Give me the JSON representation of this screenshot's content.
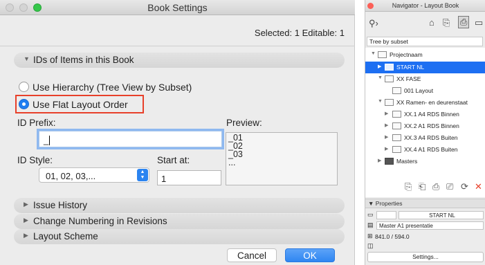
{
  "dialog": {
    "title": "Book Settings",
    "selection_info": "Selected: 1 Editable: 1",
    "sections": {
      "ids": "IDs of Items in this Book",
      "issue_history": "Issue History",
      "change_numbering": "Change Numbering in Revisions",
      "layout_scheme": "Layout Scheme"
    },
    "options": {
      "hierarchy": "Use Hierarchy (Tree View by Subset)",
      "flat": "Use Flat Layout Order",
      "selected": "flat"
    },
    "id_prefix": {
      "label": "ID Prefix:",
      "value": "_"
    },
    "preview": {
      "label": "Preview:",
      "lines": [
        "_01",
        "_02",
        "_03",
        "..."
      ]
    },
    "id_style": {
      "label": "ID Style:",
      "value": "01, 02, 03,..."
    },
    "start_at": {
      "label": "Start at:",
      "value": "1"
    },
    "buttons": {
      "cancel": "Cancel",
      "ok": "OK"
    },
    "colors": {
      "accent": "#2f86f1",
      "highlight_box": "#e8402a"
    }
  },
  "navigator": {
    "title": "Navigator - Layout Book",
    "tree_mode": "Tree by subset",
    "tree": [
      {
        "label": "Projectnaam",
        "depth": 0,
        "expanded": true,
        "icon": "book-icon"
      },
      {
        "label": "START NL",
        "depth": 1,
        "expanded": false,
        "selected": true,
        "icon": "layout-icon"
      },
      {
        "label": "XX FASE",
        "depth": 1,
        "expanded": true,
        "icon": "subset-icon"
      },
      {
        "label": "001 Layout",
        "depth": 2,
        "leaf": true,
        "icon": "layout-icon"
      },
      {
        "label": "XX Ramen- en deurenstaat",
        "depth": 1,
        "expanded": true,
        "icon": "subset-icon"
      },
      {
        "label": "XX.1 A4 RDS Binnen",
        "depth": 2,
        "expanded": false,
        "icon": "layout-icon"
      },
      {
        "label": "XX.2 A1 RDS Binnen",
        "depth": 2,
        "expanded": false,
        "icon": "layout-icon"
      },
      {
        "label": "XX.3 A4 RDS Buiten",
        "depth": 2,
        "expanded": false,
        "icon": "layout-icon"
      },
      {
        "label": "XX.4 A1 RDS Buiten",
        "depth": 2,
        "expanded": false,
        "icon": "layout-icon"
      },
      {
        "label": "Masters",
        "depth": 1,
        "expanded": false,
        "icon": "folder-icon"
      }
    ],
    "properties": {
      "header": "Properties",
      "name": "START NL",
      "master": "Master A1 presentatie",
      "size": "841.0 / 594.0",
      "settings_button": "Settings..."
    }
  }
}
